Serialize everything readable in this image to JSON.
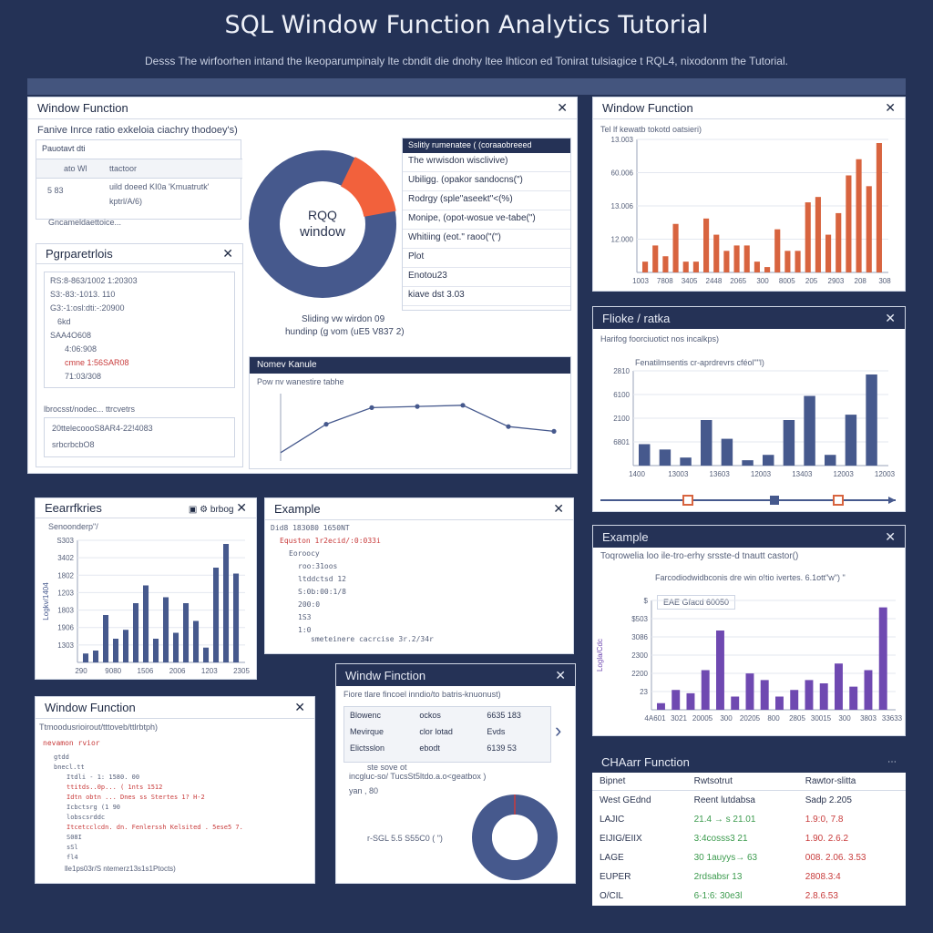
{
  "header": {
    "title": "SQL Window Function Analytics Tutorial",
    "subtitle": "Desss The wirfoorhen intand the lkeoparumpinaly lte cbndit die dnohy ltee lhticon ed Tonirat tulsiagice t RQL4, nixodonm the Tutorial."
  },
  "topleft": {
    "title": "Window Function",
    "desc": "Fanive Inrce ratio exkeloia ciachry thodoey's)",
    "inner": {
      "head": "Pauotavt dti",
      "r1_left": "ato Wl",
      "r1_right": "ttactoor",
      "r2_left": "5 83",
      "r2_right": "uild doeed KI0a 'Kmuatrutk'",
      "r3_right": "kptrl/A/6)",
      "foot": "Gncameldaettoice..."
    },
    "donut": {
      "center1": "RQQ",
      "center2": "window",
      "caption1": "Sliding vw wirdon 09",
      "caption2": "hundinp (g vom (uE5 V837 2)"
    },
    "legend": {
      "head": "Sslitly rumenatee ( (coraaobreeed",
      "items": [
        "The wrwisdon wisclivive)",
        "Ubiligg. (opakor sandocns(\")",
        "Rodrgy (sple\"aseekt\"<(%)",
        "Monipe, (opot-wosue ve-tabe(\")",
        "Whitiing (eot.\" raoo(\"(\")",
        "Plot",
        "Enotou23",
        "kiave dst 3.03"
      ]
    },
    "params": {
      "title": "Pgrparetrlois",
      "lines": [
        "RS:8-863/1002 1:20303",
        "S3:-83:-1013. 110",
        "G3:-1:osl:dti:-:20900",
        "6kd",
        "SAA4O608",
        "4:06:908",
        "cmne 1:56SAR08",
        "71:03/308"
      ],
      "section": "lbrocsst/nodec... ttrcvetrs",
      "l1": "20ttelecoooS8AR4-22!4083",
      "l2": "srbcrbcbO8"
    },
    "chart": {
      "title": "Nomev Kanule",
      "subtitle": "Pow nv wanestire tabhe"
    }
  },
  "rightbar": {
    "title": "Window Function",
    "subtitle": "Tel lf kewatb tokotd oatsieri)",
    "ylabels": [
      "13.003",
      "60.006",
      "13.006",
      "12.000"
    ],
    "xlabels": [
      "1003",
      "7808",
      "3405",
      "2448",
      "2065",
      "300",
      "8005",
      "205",
      "2903",
      "208",
      "308"
    ]
  },
  "ratio": {
    "title": "Flioke / ratka",
    "subtitle": "Harifog foorciuotict nos incalkps)",
    "ctitle": "Fenatilmsentis cr-aprdrevrs cféol\"\"l)",
    "ylabels": [
      "2810",
      "6100",
      "2100",
      "6801"
    ],
    "xlabels": [
      "1400",
      "13003",
      "13603",
      "12003",
      "13403",
      "12003",
      "12003"
    ]
  },
  "ex1": {
    "title": "Eearrfkries",
    "tag": "brbog",
    "subtitle": "Senoonderp\"/",
    "ylabels": [
      "S303",
      "3402",
      "1802",
      "1203",
      "1803",
      "1906",
      "1303"
    ],
    "yaxis": "Logkv/1404",
    "xlabels": [
      "290",
      "9080",
      "1506",
      "2006",
      "1203",
      "2305"
    ]
  },
  "ex2": {
    "title": "Example",
    "lines": [
      "Did8 183080 1650NT",
      "Equston 1r2ecid/:0:033i",
      "Eoroocy",
      "roo:31oos",
      "ltddctsd 12",
      "S:0b:00:1/8",
      "200:0",
      "1S3",
      "1:0"
    ],
    "foot": "smeteinere cacrcise 3r.2/34r"
  },
  "bottomleft": {
    "title": "Window Function",
    "subtitle": "Ttmoodusrioirout/tttoveb/ttlrbtph)",
    "head": "nevamon rvior",
    "lines": [
      "gtdd",
      "bnecl.tt",
      "Itdli - 1: 1580. 00",
      "ttitds..0p... ( 1nts 1512",
      "Idtn obtn ... Dnes ss Stertes 1? H-2",
      "Icbctsrg (1 90",
      "lobscsrddc",
      "Itcetcclcdn. dn. Fenlerssh Kelsited . 5ese5 7.",
      "S08I",
      "sSl",
      "fl4"
    ],
    "foot": "lle1ps03r/S ntemerz13s1s1Ptocts)"
  },
  "midbottom": {
    "title": "Windw Finction",
    "subtitle": "Fiore tlare fincoel inndio/to batris-knuonust)",
    "rows": [
      [
        "Blowenc",
        "ockos",
        "6635 183"
      ],
      [
        "Mevirque",
        "clor lotad",
        "Evds"
      ],
      [
        "Elictsslon",
        "ebodt",
        "6139 53"
      ]
    ],
    "line1": "ste sove ot",
    "line2": "incgluc-so/ TucsSt5ltdo.a.o<geatbox )",
    "yan": "yan , 80",
    "pie_label": "r-SGL 5.5 S55C0 ( \")"
  },
  "ex3": {
    "title": "Example",
    "subtitle": "Toqrowelia loo ile-tro-erhy srsste-d tnautt castor()",
    "ctitle": "Farcodiodwidbconis dre win o!tio ivertes. 6.1ott\"w\") \"",
    "tag": "EAE Gfacd 60050",
    "ylabels": [
      "$",
      "$503",
      "3086",
      "2300",
      "2200",
      "23"
    ],
    "yaxis": "Logla/Cdc",
    "xlabels": [
      "4A601",
      "3021",
      "20005",
      "300",
      "20205",
      "800",
      "2805",
      "30015",
      "300",
      "3803",
      "33633"
    ]
  },
  "cfunc": {
    "title": "CHAarr Function",
    "headers": [
      "Bipnet",
      "Rwtsotrut",
      "Rawtor-slitta"
    ],
    "rows": [
      [
        "West GEdnd",
        "Reent lutdabsa",
        "Sadp 2.205"
      ],
      [
        "LAJIC",
        "21.4 → s 21.01",
        "1.9:0, 7.8"
      ],
      [
        "EIJIG/EIIX",
        "3:4cosss3 21",
        "1.90. 2.6.2"
      ],
      [
        "LAGE",
        "30 1auyys→ 63",
        "008. 2.06. 3.53"
      ],
      [
        "EUPER",
        "2rdsabsr 13",
        "2808.3:4"
      ],
      [
        "O/CIL",
        "6-1:6: 30e3l",
        "2.8.6.53"
      ]
    ]
  },
  "colors": {
    "navy": "#243256",
    "orange": "#d8643f",
    "blue": "#46598d",
    "purple": "#6f49b1",
    "green": "#3c9b4e",
    "red": "#c83b3b"
  },
  "chart_data": [
    {
      "type": "bar",
      "title": "Tel lf kewatb tokotd oatsieri)",
      "values": [
        2,
        5,
        3,
        9,
        2,
        2,
        10,
        7,
        4,
        5,
        5,
        2,
        1,
        8,
        4,
        4,
        13,
        14,
        7,
        11,
        18,
        21,
        16,
        24
      ]
    },
    {
      "type": "bar",
      "title": "Fenatilmsentis cr-aprdrevrs cféol\"\"l)",
      "values": [
        4,
        3,
        1.5,
        8.5,
        5,
        1,
        2,
        8.5,
        13,
        2,
        9.5,
        17
      ]
    },
    {
      "type": "bar",
      "title": "Senoonderp\"/",
      "values": [
        1.5,
        2,
        8,
        4,
        5.5,
        10,
        13,
        4,
        11,
        5,
        10,
        7,
        2.5,
        16,
        20,
        15
      ]
    },
    {
      "type": "bar",
      "title": "Farcodiodwidbconis dre win o!tio ivertes. 6.1ott\"w\") \"",
      "values": [
        1,
        3,
        2.5,
        6,
        12,
        2,
        5.5,
        4.5,
        2,
        3,
        4.5,
        4,
        7,
        3.5,
        6,
        15.5
      ]
    },
    {
      "type": "line",
      "title": "Nomev Kanule",
      "values": [
        2,
        14,
        21,
        21.5,
        22,
        13,
        11
      ]
    },
    {
      "type": "pie",
      "title": "RQQ window",
      "values": [
        85,
        15
      ]
    }
  ]
}
